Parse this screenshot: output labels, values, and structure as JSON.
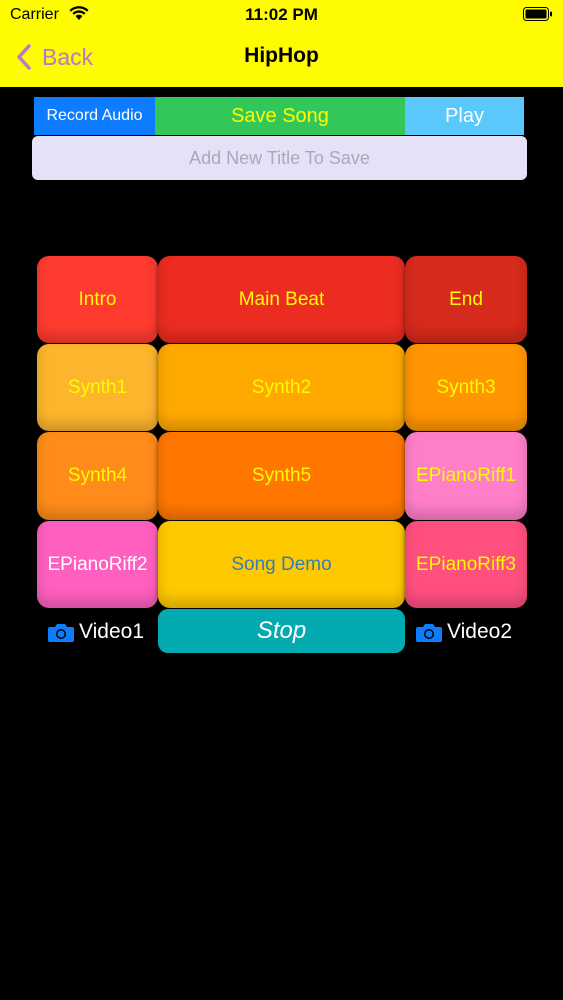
{
  "status_bar": {
    "carrier": "Carrier",
    "time": "11:02 PM"
  },
  "nav": {
    "back_label": "Back",
    "title": "HipHop"
  },
  "toolbar": {
    "record_label": "Record Audio",
    "save_label": "Save Song",
    "play_label": "Play",
    "title_placeholder": "Add New Title To Save"
  },
  "pads": [
    {
      "label": "Intro",
      "bg": "#ff3b30",
      "fg": "#fffb00"
    },
    {
      "label": "Main Beat",
      "bg": "#ec2c20",
      "fg": "#fffb00"
    },
    {
      "label": "End",
      "bg": "#d62a1c",
      "fg": "#fffb00"
    },
    {
      "label": "Synth1",
      "bg": "#fdb52e",
      "fg": "#fffb00"
    },
    {
      "label": "Synth2",
      "bg": "#ffa800",
      "fg": "#fffb00"
    },
    {
      "label": "Synth3",
      "bg": "#ff9500",
      "fg": "#fffb00"
    },
    {
      "label": "Synth4",
      "bg": "#ff8c1a",
      "fg": "#fffb00"
    },
    {
      "label": "Synth5",
      "bg": "#ff7700",
      "fg": "#fffb00"
    },
    {
      "label": "EPianoRiff1",
      "bg": "#ff7ec8",
      "fg": "#fffb00"
    },
    {
      "label": "EPianoRiff2",
      "bg": "#ff5fbf",
      "fg": "#ffffff"
    },
    {
      "label": "Song Demo",
      "bg": "#ffc900",
      "fg": "#2f7fb8"
    },
    {
      "label": "EPianoRiff3",
      "bg": "#ff4f7f",
      "fg": "#fffb00"
    }
  ],
  "controls": {
    "stop_label": "Stop",
    "video1_label": "Video1",
    "video2_label": "Video2",
    "camera_icon_color": "#0d7cff"
  },
  "colors": {
    "nav_bg": "#fffb00",
    "back_tint": "#b67ac9",
    "record_bg": "#0d7cff",
    "save_bg": "#33c759",
    "play_bg": "#5ac8fa",
    "stop_bg": "#03aab0"
  }
}
